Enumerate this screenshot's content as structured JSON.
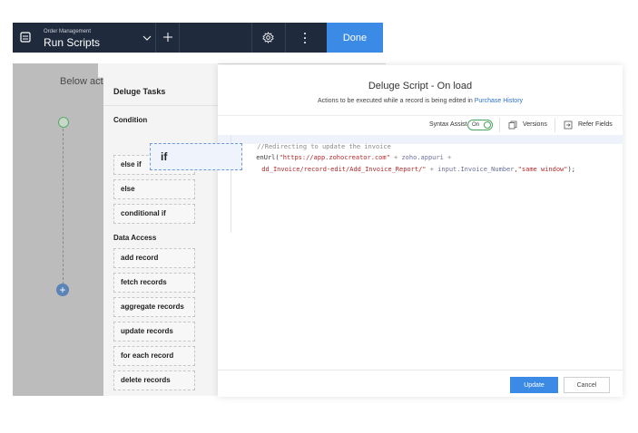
{
  "topbar": {
    "subtitle": "Order Management",
    "title": "Run Scripts",
    "done_label": "Done"
  },
  "canvas": {
    "text": "Below act"
  },
  "tasks": {
    "title": "Deluge Tasks",
    "condition_label": "Condition",
    "condition_items": [
      "else if",
      "else",
      "conditional if"
    ],
    "data_access_label": "Data Access",
    "data_access_items": [
      "add record",
      "fetch records",
      "aggregate records",
      "update records",
      "for each record",
      "delete records"
    ]
  },
  "drag_card": {
    "label": "if"
  },
  "editor": {
    "title": "Deluge Script - On load",
    "subtitle_prefix": "Actions to be executed while a record is being edited in ",
    "subtitle_link": "Purchase History",
    "syntax_assist_label": "Syntax Assist",
    "syntax_assist_state": "On",
    "versions_label": "Versions",
    "refer_fields_label": "Refer Fields",
    "code": {
      "line1": "//Redirecting to update the invoice",
      "line2_fn": "enUrl(",
      "line2_str": "\"https://app.zohocreator.com\"",
      "line2_op": " + ",
      "line2_var": "zoho.appuri",
      "line2_tail": " +",
      "line3_str": "dd_Invoice/record-edit/Add_Invoice_Report/\"",
      "line3_op": " + ",
      "line3_var": "input.Invoice_Number",
      "line3_str2": ",\"same window\"",
      "line3_end": ");"
    },
    "update_label": "Update",
    "cancel_label": "Cancel"
  },
  "colors": {
    "topbar_bg": "#1f2a3c",
    "primary_blue": "#3b8be6",
    "toggle_green": "#49a55c",
    "link": "#2f73c8"
  }
}
